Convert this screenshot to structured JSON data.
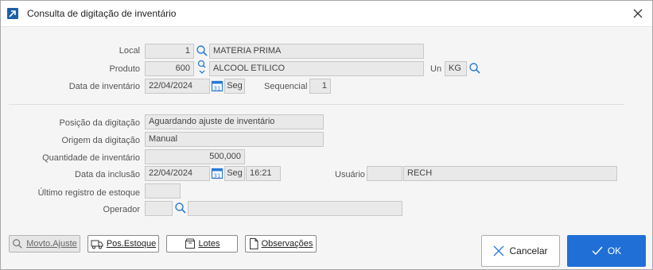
{
  "window": {
    "title": "Consulta de digitação de inventário"
  },
  "form": {
    "local_label": "Local",
    "local_code": "1",
    "local_name": "MATERIA PRIMA",
    "produto_label": "Produto",
    "produto_code": "600",
    "produto_name": "ALCOOL ETILICO",
    "un_label": "Un",
    "un_value": "KG",
    "data_inv_label": "Data de inventário",
    "data_inv_value": "22/04/2024",
    "data_inv_day": "Seg",
    "sequencial_label": "Sequencial",
    "sequencial_value": "1",
    "posicao_label": "Posição da digitação",
    "posicao_value": "Aguardando ajuste de inventário",
    "origem_label": "Origem da digitação",
    "origem_value": "Manual",
    "quantidade_label": "Quantidade de inventário",
    "quantidade_value": "500,000",
    "data_inclusao_label": "Data da inclusão",
    "data_inclusao_value": "22/04/2024",
    "data_inclusao_day": "Seg",
    "data_inclusao_time": "16:21",
    "usuario_label": "Usuário",
    "usuario_code": "",
    "usuario_name": "RECH",
    "ultimo_registro_label": "Último registro de estoque",
    "ultimo_registro_value": "",
    "operador_label": "Operador",
    "operador_code": "",
    "operador_name": ""
  },
  "buttons": {
    "movto_ajuste": "Movto.Ajuste",
    "pos_estoque": "Pos.Estoque",
    "lotes": "Lotes",
    "observacoes": "Observações",
    "cancelar": "Cancelar",
    "ok": "OK"
  },
  "colors": {
    "accent": "#1f6fd6",
    "field_bg": "#e9e9e9",
    "window_bg": "#f5f5f5"
  }
}
